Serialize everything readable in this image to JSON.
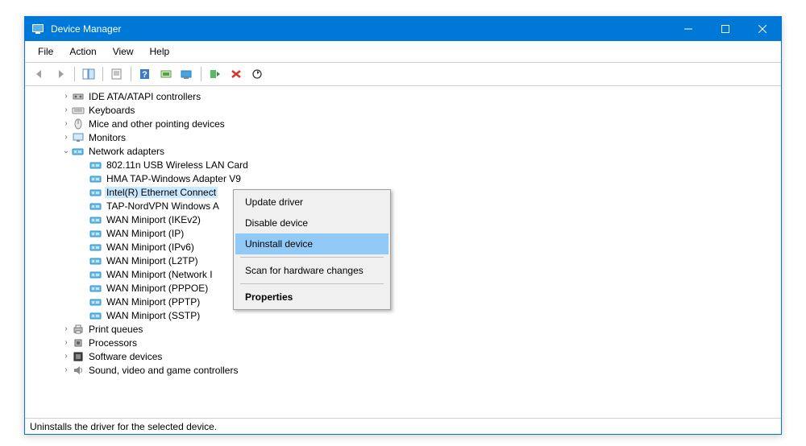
{
  "window": {
    "title": "Device Manager"
  },
  "menubar": {
    "file": "File",
    "action": "Action",
    "view": "View",
    "help": "Help"
  },
  "toolbar": {
    "back": "Back",
    "forward": "Forward",
    "upshow": "Show/Hide",
    "properties": "Properties",
    "help": "Help",
    "update": "Update",
    "scan": "Scan",
    "enable": "Enable",
    "uninstall": "Uninstall",
    "monitor": "View"
  },
  "tree": {
    "items": [
      {
        "label": "IDE ATA/ATAPI controllers",
        "indent": 1,
        "expander": "›",
        "icon": "ide"
      },
      {
        "label": "Keyboards",
        "indent": 1,
        "expander": "›",
        "icon": "keyboard"
      },
      {
        "label": "Mice and other pointing devices",
        "indent": 1,
        "expander": "›",
        "icon": "mouse"
      },
      {
        "label": "Monitors",
        "indent": 1,
        "expander": "›",
        "icon": "monitor"
      },
      {
        "label": "Network adapters",
        "indent": 1,
        "expander": "⌄",
        "icon": "net"
      },
      {
        "label": "802.11n USB Wireless LAN Card",
        "indent": 2,
        "expander": "",
        "icon": "net"
      },
      {
        "label": "HMA TAP-Windows Adapter V9",
        "indent": 2,
        "expander": "",
        "icon": "net"
      },
      {
        "label": "Intel(R) Ethernet Connect",
        "indent": 2,
        "expander": "",
        "icon": "net",
        "selected": true
      },
      {
        "label": "TAP-NordVPN Windows A",
        "indent": 2,
        "expander": "",
        "icon": "net"
      },
      {
        "label": "WAN Miniport (IKEv2)",
        "indent": 2,
        "expander": "",
        "icon": "net"
      },
      {
        "label": "WAN Miniport (IP)",
        "indent": 2,
        "expander": "",
        "icon": "net"
      },
      {
        "label": "WAN Miniport (IPv6)",
        "indent": 2,
        "expander": "",
        "icon": "net"
      },
      {
        "label": "WAN Miniport (L2TP)",
        "indent": 2,
        "expander": "",
        "icon": "net"
      },
      {
        "label": "WAN Miniport (Network I",
        "indent": 2,
        "expander": "",
        "icon": "net"
      },
      {
        "label": "WAN Miniport (PPPOE)",
        "indent": 2,
        "expander": "",
        "icon": "net"
      },
      {
        "label": "WAN Miniport (PPTP)",
        "indent": 2,
        "expander": "",
        "icon": "net"
      },
      {
        "label": "WAN Miniport (SSTP)",
        "indent": 2,
        "expander": "",
        "icon": "net"
      },
      {
        "label": "Print queues",
        "indent": 1,
        "expander": "›",
        "icon": "print"
      },
      {
        "label": "Processors",
        "indent": 1,
        "expander": "›",
        "icon": "cpu"
      },
      {
        "label": "Software devices",
        "indent": 1,
        "expander": "›",
        "icon": "soft"
      },
      {
        "label": "Sound, video and game controllers",
        "indent": 1,
        "expander": "›",
        "icon": "sound"
      }
    ]
  },
  "contextmenu": {
    "update": "Update driver",
    "disable": "Disable device",
    "uninstall": "Uninstall device",
    "scan": "Scan for hardware changes",
    "properties": "Properties"
  },
  "statusbar": {
    "text": "Uninstalls the driver for the selected device."
  }
}
